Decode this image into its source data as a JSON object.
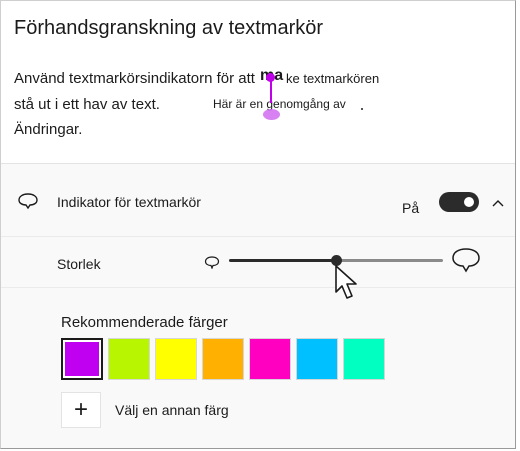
{
  "preview": {
    "title": "Förhandsgranskning av textmarkör",
    "line1": "Använd textmarkörsindikatorn för att",
    "line2": "stå ut i ett hav av text.",
    "line3": "Ändringar.",
    "overlay_word": "ma",
    "overlay_tail": "ke textmarkören",
    "overlay_sub": "Här är en genomgång av"
  },
  "indicator": {
    "label": "Indikator för textmarkör",
    "state_label": "På",
    "toggle_on": true
  },
  "size": {
    "label": "Storlek"
  },
  "colors": {
    "label": "Rekommenderade färger",
    "swatches": [
      "#c000f0",
      "#b8f500",
      "#ffff00",
      "#ffb000",
      "#ff00c0",
      "#00c0ff",
      "#00ffc0"
    ],
    "selected_index": 0,
    "add_label": "Välj en annan färg",
    "add_symbol": "+"
  },
  "icons": {
    "indicator": "cursor-indicator-icon",
    "chevron": "chevron-up-icon",
    "slider_small": "small-cursor-icon",
    "slider_large": "large-cursor-icon",
    "mouse": "mouse-pointer-icon"
  },
  "accent": "#c000e8"
}
